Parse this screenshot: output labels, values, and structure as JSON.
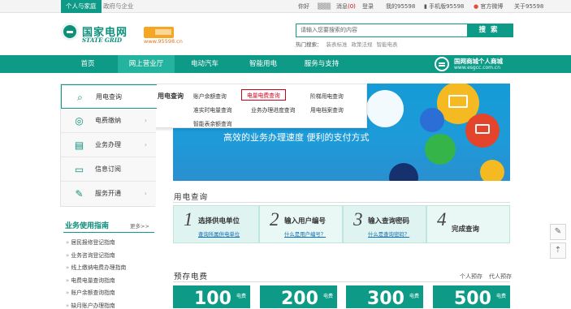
{
  "topbar": {
    "tab_personal": "个人与家庭",
    "tab_gov": "政府与企业",
    "greeting": "你好",
    "login": "登录",
    "messages_label": "消息",
    "messages_count": "(0)",
    "my_site": "我的95598",
    "mobile": "手机版95598",
    "weibo": "官方微博",
    "about": "关于95598"
  },
  "header": {
    "logo_cn": "国家电网",
    "logo_en": "STATE GRID",
    "site_url": "www.95598.cn",
    "search_placeholder": "请输入您要搜索的内容",
    "search_button": "搜索",
    "hot_label": "热门搜索：",
    "hot_items": [
      "装表标准",
      "政策法规",
      "智能电表"
    ]
  },
  "nav": {
    "items": [
      "首页",
      "网上营业厅",
      "电动汽车",
      "智能用电",
      "服务与支持"
    ],
    "mall_title": "国网商城个人商城",
    "mall_url": "www.esgcc.com.cn"
  },
  "sidebar": {
    "items": [
      {
        "label": "用电查询",
        "icon": "search-icon"
      },
      {
        "label": "电费缴纳",
        "icon": "coin-icon"
      },
      {
        "label": "业务办理",
        "icon": "document-icon"
      },
      {
        "label": "信息订阅",
        "icon": "monitor-icon"
      },
      {
        "label": "服务开通",
        "icon": "edit-icon"
      }
    ],
    "guide_title": "业务使用指南",
    "guide_more": "更多>>",
    "guide_items": [
      "居民报修登记指南",
      "业务咨询登记指南",
      "线上缴纳电费办理指南",
      "电费电量查询指南",
      "账户余额查询指南",
      "缺月账户办理指南"
    ]
  },
  "dropdown": {
    "title": "用电查询",
    "links": [
      "账户余额查询",
      "电量电费查询",
      "阶梯用电查询",
      "准实时电量查询",
      "业务办理进度查询",
      "用电档案查询",
      "智能表余额查询"
    ],
    "highlighted": "电量电费查询"
  },
  "banner": {
    "slogan": "高效的业务办理速度  便利的支付方式"
  },
  "usage_query": {
    "title": "用电查询",
    "steps": [
      {
        "num": "1",
        "title": "选择供电单位",
        "link": "查询所属供电单位"
      },
      {
        "num": "2",
        "title": "输入用户编号",
        "link": "什么是用户编号？"
      },
      {
        "num": "3",
        "title": "输入查询密码",
        "link": "什么是查询密码？"
      },
      {
        "num": "4",
        "title": "完成查询",
        "link": ""
      }
    ]
  },
  "prepay": {
    "title": "预存电费",
    "links": [
      "个人预存",
      "代人预存"
    ],
    "cards": [
      {
        "amount": "100",
        "unit": "电费"
      },
      {
        "amount": "200",
        "unit": "电费"
      },
      {
        "amount": "300",
        "unit": "电费"
      },
      {
        "amount": "500",
        "unit": "电费"
      }
    ]
  },
  "colors": {
    "primary": "#0d9a86",
    "banner": "#1d9bd9",
    "highlight": "#d0021b"
  }
}
